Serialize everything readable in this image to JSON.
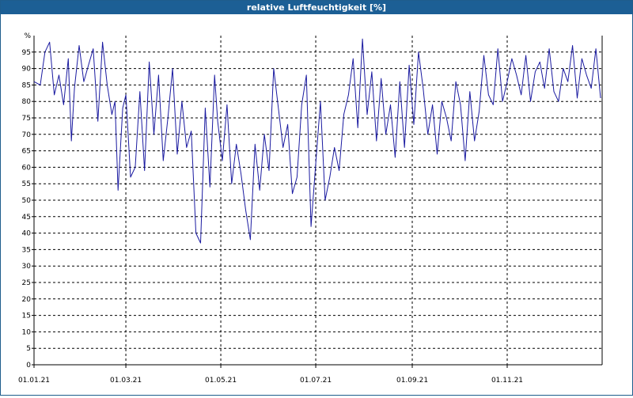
{
  "window": {
    "title": "relative Luftfeuchtigkeit [%]"
  },
  "chart_data": {
    "type": "line",
    "title": "relative Luftfeuchtigkeit [%]",
    "ylabel": "%",
    "xlabel": "",
    "ylim": [
      0,
      100
    ],
    "xlim": [
      "2021-01-01",
      "2021-12-31"
    ],
    "y_ticks": [
      0,
      5,
      10,
      15,
      20,
      25,
      30,
      35,
      40,
      45,
      50,
      55,
      60,
      65,
      70,
      75,
      80,
      85,
      90,
      95
    ],
    "x_ticks": [
      {
        "date": "2021-01-01",
        "label": "01.01.21"
      },
      {
        "date": "2021-03-01",
        "label": "01.03.21"
      },
      {
        "date": "2021-05-01",
        "label": "01.05.21"
      },
      {
        "date": "2021-07-01",
        "label": "01.07.21"
      },
      {
        "date": "2021-09-01",
        "label": "01.09.21"
      },
      {
        "date": "2021-11-01",
        "label": "01.11.21"
      }
    ],
    "grid": true,
    "colors": {
      "line": "#1a1aa0",
      "grid": "#000000",
      "title_bar": "#1c5f95"
    },
    "series": [
      {
        "x": [
          "2021-01-01",
          "2021-01-05",
          "2021-01-08",
          "2021-01-11",
          "2021-01-14",
          "2021-01-17",
          "2021-01-20",
          "2021-01-23",
          "2021-01-25",
          "2021-01-27",
          "2021-01-30",
          "2021-02-02",
          "2021-02-05",
          "2021-02-08",
          "2021-02-11",
          "2021-02-14",
          "2021-02-17",
          "2021-02-20",
          "2021-02-22",
          "2021-02-24",
          "2021-02-27",
          "2021-03-01",
          "2021-03-04",
          "2021-03-07",
          "2021-03-10",
          "2021-03-13",
          "2021-03-16",
          "2021-03-19",
          "2021-03-22",
          "2021-03-25",
          "2021-03-28",
          "2021-03-31",
          "2021-04-03",
          "2021-04-06",
          "2021-04-09",
          "2021-04-12",
          "2021-04-15",
          "2021-04-18",
          "2021-04-21",
          "2021-04-24",
          "2021-04-27",
          "2021-04-29",
          "2021-05-02",
          "2021-05-05",
          "2021-05-08",
          "2021-05-11",
          "2021-05-14",
          "2021-05-17",
          "2021-05-20",
          "2021-05-23",
          "2021-05-26",
          "2021-05-29",
          "2021-06-01",
          "2021-06-04",
          "2021-06-07",
          "2021-06-10",
          "2021-06-13",
          "2021-06-16",
          "2021-06-19",
          "2021-06-22",
          "2021-06-25",
          "2021-06-28",
          "2021-07-01",
          "2021-07-04",
          "2021-07-07",
          "2021-07-10",
          "2021-07-13",
          "2021-07-16",
          "2021-07-19",
          "2021-07-22",
          "2021-07-25",
          "2021-07-28",
          "2021-07-31",
          "2021-08-03",
          "2021-08-06",
          "2021-08-09",
          "2021-08-12",
          "2021-08-15",
          "2021-08-18",
          "2021-08-21",
          "2021-08-24",
          "2021-08-27",
          "2021-08-30",
          "2021-09-02",
          "2021-09-05",
          "2021-09-08",
          "2021-09-11",
          "2021-09-14",
          "2021-09-17",
          "2021-09-20",
          "2021-09-23",
          "2021-09-26",
          "2021-09-29",
          "2021-10-02",
          "2021-10-05",
          "2021-10-08",
          "2021-10-11",
          "2021-10-14",
          "2021-10-17",
          "2021-10-20",
          "2021-10-23",
          "2021-10-26",
          "2021-10-29",
          "2021-11-01",
          "2021-11-04",
          "2021-11-07",
          "2021-11-10",
          "2021-11-13",
          "2021-11-16",
          "2021-11-19",
          "2021-11-22",
          "2021-11-25",
          "2021-11-28",
          "2021-12-01",
          "2021-12-04",
          "2021-12-07",
          "2021-12-10",
          "2021-12-13",
          "2021-12-16",
          "2021-12-19",
          "2021-12-22",
          "2021-12-25",
          "2021-12-28",
          "2021-12-31"
        ],
        "y": [
          86,
          85,
          95,
          98,
          82,
          88,
          79,
          93,
          68,
          84,
          97,
          86,
          91,
          96,
          74,
          98,
          85,
          76,
          80,
          53,
          78,
          82,
          57,
          60,
          83,
          59,
          92,
          70,
          88,
          62,
          75,
          90,
          64,
          80,
          66,
          71,
          40,
          37,
          78,
          54,
          88,
          74,
          62,
          79,
          55,
          67,
          58,
          47,
          38,
          67,
          53,
          70,
          59,
          90,
          78,
          66,
          73,
          52,
          57,
          79,
          88,
          42,
          61,
          80,
          50,
          57,
          66,
          59,
          76,
          82,
          93,
          72,
          99,
          76,
          89,
          68,
          87,
          70,
          79,
          63,
          86,
          66,
          91,
          73,
          95,
          84,
          70,
          79,
          64,
          80,
          75,
          68,
          86,
          79,
          62,
          83,
          68,
          77,
          94,
          82,
          79,
          96,
          80,
          86,
          93,
          88,
          82,
          94,
          80,
          89,
          92,
          84,
          96,
          83,
          80,
          90,
          86,
          97,
          81,
          93,
          88,
          84,
          96,
          81
        ]
      }
    ]
  }
}
